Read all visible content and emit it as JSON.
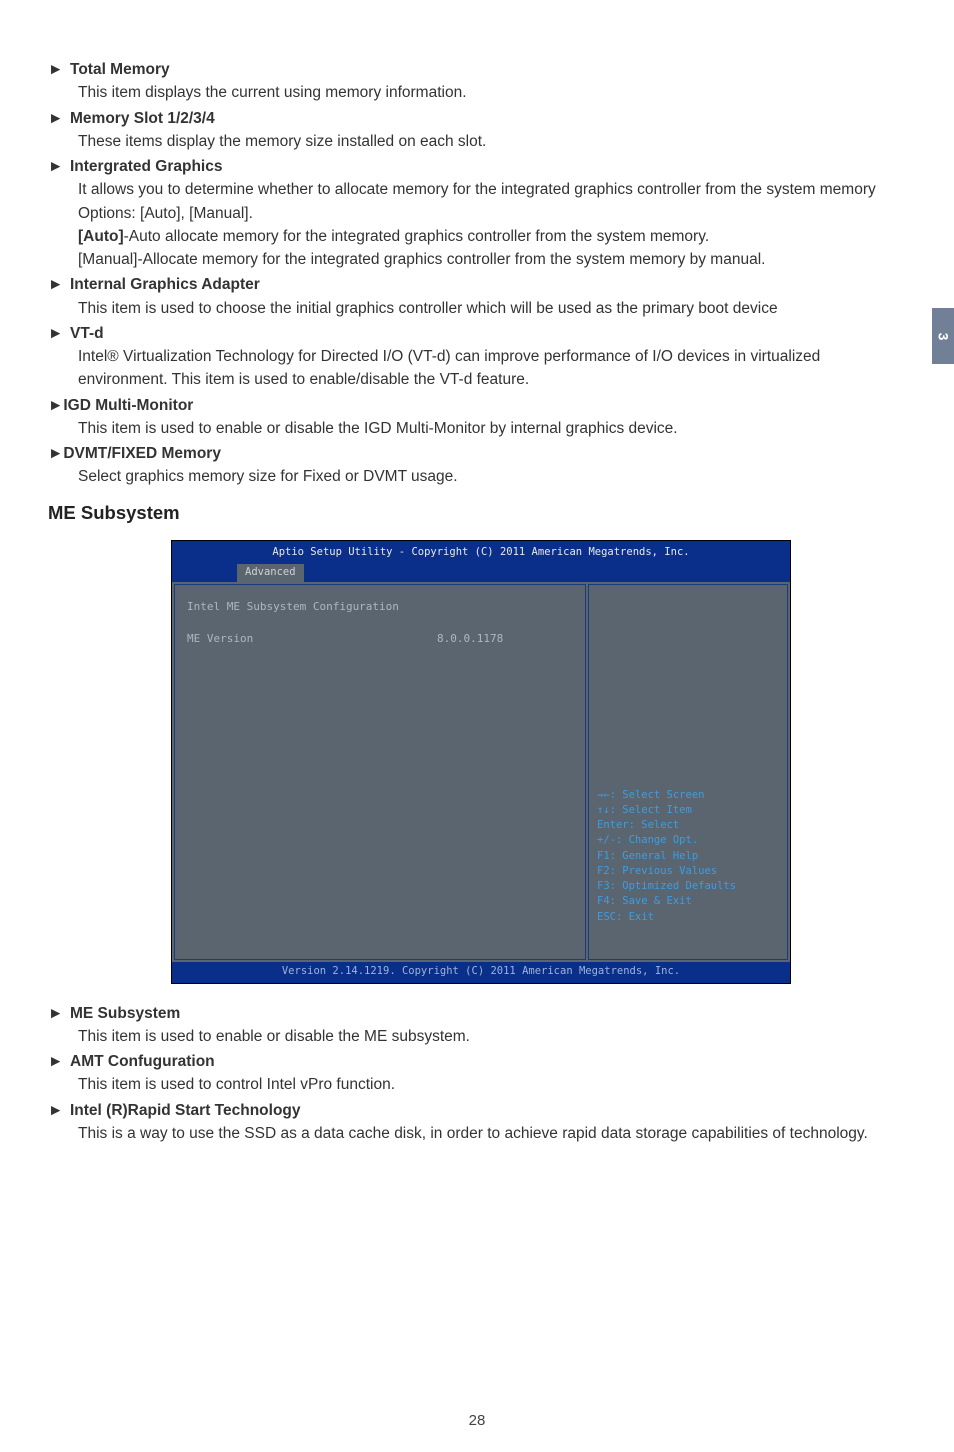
{
  "sideTab": "3",
  "items": [
    {
      "title": "Total Memory",
      "desc": "This item displays the current using memory information."
    },
    {
      "title": "Memory Slot 1/2/3/4",
      "desc": "These items display the memory size installed on each slot."
    },
    {
      "title": "Intergrated Graphics",
      "desc": "It allows you to determine whether to allocate memory for the integrated graphics controller from the system memory Options: [Auto], [Manual].",
      "extraBoldLabel": "[Auto]",
      "extraBoldRest": "-Auto allocate memory for the integrated graphics controller from the system memory.",
      "extra2": "[Manual]-Allocate memory for the integrated graphics controller from the system memory by manual."
    },
    {
      "title": "Internal Graphics Adapter",
      "desc": "This item is used to choose the initial graphics controller which will be used as the primary boot device"
    },
    {
      "title": "VT-d",
      "desc": "Intel® Virtualization Technology for Directed I/O (VT-d) can improve performance of I/O devices in virtualized environment. This item is used to enable/disable the VT-d feature."
    },
    {
      "title": "IGD Multi-Monitor",
      "desc": "This item is used to enable or disable the IGD Multi-Monitor by internal graphics device.",
      "tight": true
    },
    {
      "title": "DVMT/FIXED Memory",
      "desc": "Select graphics memory size for Fixed or DVMT usage.",
      "tight": true
    }
  ],
  "subHeading": "ME Subsystem",
  "bios": {
    "header": "Aptio Setup Utility - Copyright (C) 2011 American Megatrends, Inc.",
    "tab": "Advanced",
    "leftTitle": "Intel ME Subsystem Configuration",
    "verLabel": "ME Version",
    "verValue": "8.0.0.1178",
    "help": [
      "→←: Select Screen",
      "↑↓: Select Item",
      "Enter: Select",
      "+/-: Change Opt.",
      "F1: General Help",
      "F2: Previous Values",
      "F3: Optimized Defaults",
      "F4: Save & Exit",
      "ESC: Exit"
    ],
    "footer": "Version 2.14.1219. Copyright (C) 2011 American Megatrends, Inc."
  },
  "afterItems": [
    {
      "title": "ME Subsystem",
      "desc": "This item is used to enable or disable the ME subsystem."
    },
    {
      "title": "AMT Confuguration",
      "desc": "This item is used to control Intel vPro function."
    },
    {
      "title": "Intel (R)Rapid Start Technology",
      "desc": "This is a way to use the SSD as a data cache disk, in order to achieve rapid data storage capabilities of technology."
    }
  ],
  "marker": "►",
  "pageNum": "28"
}
